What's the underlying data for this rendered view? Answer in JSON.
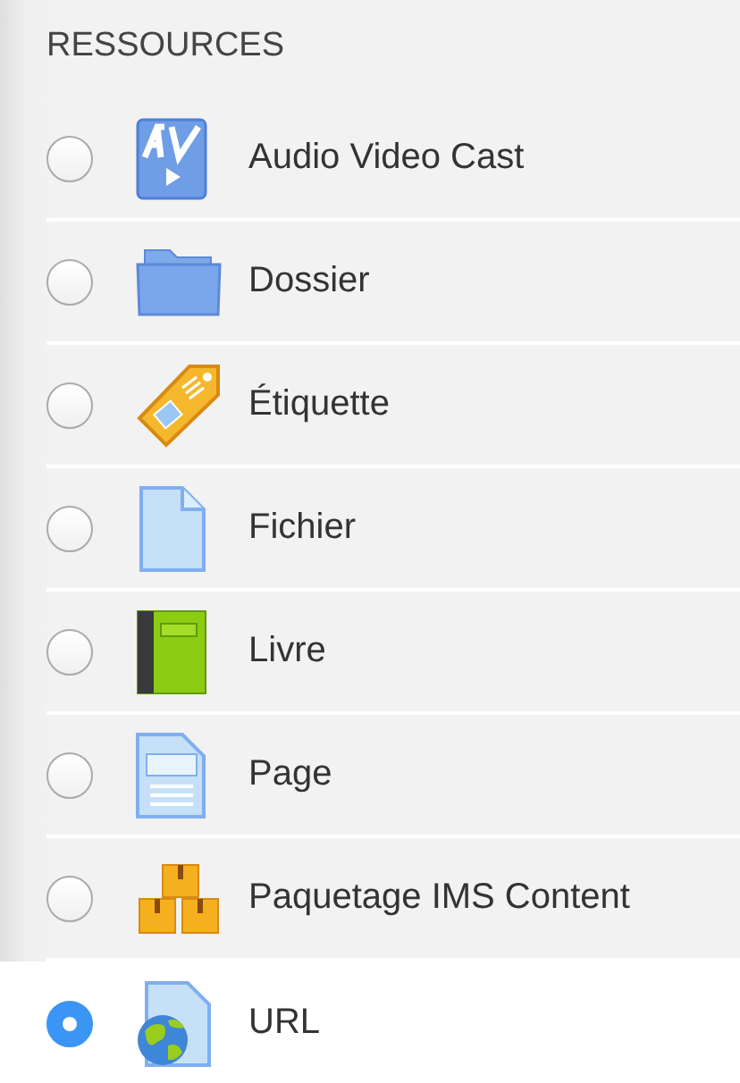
{
  "heading": "RESSOURCES",
  "items": [
    {
      "label": "Audio Video Cast",
      "kind": "av",
      "selected": false
    },
    {
      "label": "Dossier",
      "kind": "folder",
      "selected": false
    },
    {
      "label": "Étiquette",
      "kind": "tag",
      "selected": false
    },
    {
      "label": "Fichier",
      "kind": "file",
      "selected": false
    },
    {
      "label": "Livre",
      "kind": "book",
      "selected": false
    },
    {
      "label": "Page",
      "kind": "page",
      "selected": false
    },
    {
      "label": "Paquetage IMS Content",
      "kind": "boxes",
      "selected": false
    },
    {
      "label": "URL",
      "kind": "url",
      "selected": true
    }
  ]
}
